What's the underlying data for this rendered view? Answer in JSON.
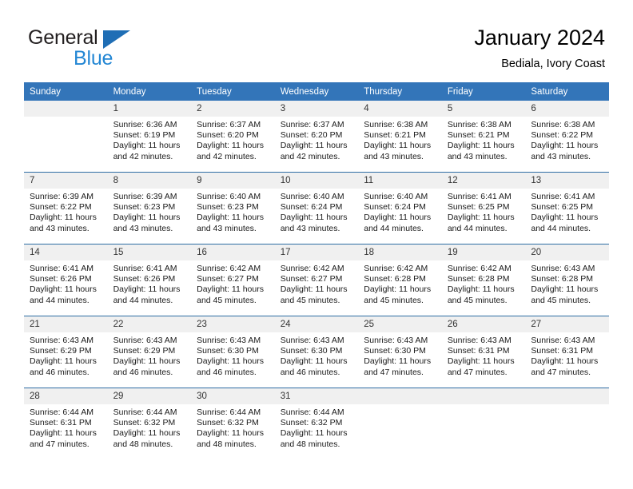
{
  "brand": {
    "name_part1": "General",
    "name_part2": "Blue",
    "triangle_icon": "triangle-icon"
  },
  "header": {
    "title": "January 2024",
    "subtitle": "Bediala, Ivory Coast"
  },
  "colors": {
    "header_blue": "#3375b9",
    "row_divider_blue": "#2e6da4",
    "daynum_band": "#f0f0f0",
    "brand_blue": "#2487d4",
    "logo_triangle": "#1f6eb5"
  },
  "weekdays": [
    "Sunday",
    "Monday",
    "Tuesday",
    "Wednesday",
    "Thursday",
    "Friday",
    "Saturday"
  ],
  "weeks": [
    [
      {
        "day": "",
        "sunrise": "",
        "sunset": "",
        "daylight": "",
        "daylight2": "",
        "blank": true
      },
      {
        "day": "1",
        "sunrise": "Sunrise: 6:36 AM",
        "sunset": "Sunset: 6:19 PM",
        "daylight": "Daylight: 11 hours",
        "daylight2": "and 42 minutes."
      },
      {
        "day": "2",
        "sunrise": "Sunrise: 6:37 AM",
        "sunset": "Sunset: 6:20 PM",
        "daylight": "Daylight: 11 hours",
        "daylight2": "and 42 minutes."
      },
      {
        "day": "3",
        "sunrise": "Sunrise: 6:37 AM",
        "sunset": "Sunset: 6:20 PM",
        "daylight": "Daylight: 11 hours",
        "daylight2": "and 42 minutes."
      },
      {
        "day": "4",
        "sunrise": "Sunrise: 6:38 AM",
        "sunset": "Sunset: 6:21 PM",
        "daylight": "Daylight: 11 hours",
        "daylight2": "and 43 minutes."
      },
      {
        "day": "5",
        "sunrise": "Sunrise: 6:38 AM",
        "sunset": "Sunset: 6:21 PM",
        "daylight": "Daylight: 11 hours",
        "daylight2": "and 43 minutes."
      },
      {
        "day": "6",
        "sunrise": "Sunrise: 6:38 AM",
        "sunset": "Sunset: 6:22 PM",
        "daylight": "Daylight: 11 hours",
        "daylight2": "and 43 minutes."
      }
    ],
    [
      {
        "day": "7",
        "sunrise": "Sunrise: 6:39 AM",
        "sunset": "Sunset: 6:22 PM",
        "daylight": "Daylight: 11 hours",
        "daylight2": "and 43 minutes."
      },
      {
        "day": "8",
        "sunrise": "Sunrise: 6:39 AM",
        "sunset": "Sunset: 6:23 PM",
        "daylight": "Daylight: 11 hours",
        "daylight2": "and 43 minutes."
      },
      {
        "day": "9",
        "sunrise": "Sunrise: 6:40 AM",
        "sunset": "Sunset: 6:23 PM",
        "daylight": "Daylight: 11 hours",
        "daylight2": "and 43 minutes."
      },
      {
        "day": "10",
        "sunrise": "Sunrise: 6:40 AM",
        "sunset": "Sunset: 6:24 PM",
        "daylight": "Daylight: 11 hours",
        "daylight2": "and 43 minutes."
      },
      {
        "day": "11",
        "sunrise": "Sunrise: 6:40 AM",
        "sunset": "Sunset: 6:24 PM",
        "daylight": "Daylight: 11 hours",
        "daylight2": "and 44 minutes."
      },
      {
        "day": "12",
        "sunrise": "Sunrise: 6:41 AM",
        "sunset": "Sunset: 6:25 PM",
        "daylight": "Daylight: 11 hours",
        "daylight2": "and 44 minutes."
      },
      {
        "day": "13",
        "sunrise": "Sunrise: 6:41 AM",
        "sunset": "Sunset: 6:25 PM",
        "daylight": "Daylight: 11 hours",
        "daylight2": "and 44 minutes."
      }
    ],
    [
      {
        "day": "14",
        "sunrise": "Sunrise: 6:41 AM",
        "sunset": "Sunset: 6:26 PM",
        "daylight": "Daylight: 11 hours",
        "daylight2": "and 44 minutes."
      },
      {
        "day": "15",
        "sunrise": "Sunrise: 6:41 AM",
        "sunset": "Sunset: 6:26 PM",
        "daylight": "Daylight: 11 hours",
        "daylight2": "and 44 minutes."
      },
      {
        "day": "16",
        "sunrise": "Sunrise: 6:42 AM",
        "sunset": "Sunset: 6:27 PM",
        "daylight": "Daylight: 11 hours",
        "daylight2": "and 45 minutes."
      },
      {
        "day": "17",
        "sunrise": "Sunrise: 6:42 AM",
        "sunset": "Sunset: 6:27 PM",
        "daylight": "Daylight: 11 hours",
        "daylight2": "and 45 minutes."
      },
      {
        "day": "18",
        "sunrise": "Sunrise: 6:42 AM",
        "sunset": "Sunset: 6:28 PM",
        "daylight": "Daylight: 11 hours",
        "daylight2": "and 45 minutes."
      },
      {
        "day": "19",
        "sunrise": "Sunrise: 6:42 AM",
        "sunset": "Sunset: 6:28 PM",
        "daylight": "Daylight: 11 hours",
        "daylight2": "and 45 minutes."
      },
      {
        "day": "20",
        "sunrise": "Sunrise: 6:43 AM",
        "sunset": "Sunset: 6:28 PM",
        "daylight": "Daylight: 11 hours",
        "daylight2": "and 45 minutes."
      }
    ],
    [
      {
        "day": "21",
        "sunrise": "Sunrise: 6:43 AM",
        "sunset": "Sunset: 6:29 PM",
        "daylight": "Daylight: 11 hours",
        "daylight2": "and 46 minutes."
      },
      {
        "day": "22",
        "sunrise": "Sunrise: 6:43 AM",
        "sunset": "Sunset: 6:29 PM",
        "daylight": "Daylight: 11 hours",
        "daylight2": "and 46 minutes."
      },
      {
        "day": "23",
        "sunrise": "Sunrise: 6:43 AM",
        "sunset": "Sunset: 6:30 PM",
        "daylight": "Daylight: 11 hours",
        "daylight2": "and 46 minutes."
      },
      {
        "day": "24",
        "sunrise": "Sunrise: 6:43 AM",
        "sunset": "Sunset: 6:30 PM",
        "daylight": "Daylight: 11 hours",
        "daylight2": "and 46 minutes."
      },
      {
        "day": "25",
        "sunrise": "Sunrise: 6:43 AM",
        "sunset": "Sunset: 6:30 PM",
        "daylight": "Daylight: 11 hours",
        "daylight2": "and 47 minutes."
      },
      {
        "day": "26",
        "sunrise": "Sunrise: 6:43 AM",
        "sunset": "Sunset: 6:31 PM",
        "daylight": "Daylight: 11 hours",
        "daylight2": "and 47 minutes."
      },
      {
        "day": "27",
        "sunrise": "Sunrise: 6:43 AM",
        "sunset": "Sunset: 6:31 PM",
        "daylight": "Daylight: 11 hours",
        "daylight2": "and 47 minutes."
      }
    ],
    [
      {
        "day": "28",
        "sunrise": "Sunrise: 6:44 AM",
        "sunset": "Sunset: 6:31 PM",
        "daylight": "Daylight: 11 hours",
        "daylight2": "and 47 minutes."
      },
      {
        "day": "29",
        "sunrise": "Sunrise: 6:44 AM",
        "sunset": "Sunset: 6:32 PM",
        "daylight": "Daylight: 11 hours",
        "daylight2": "and 48 minutes."
      },
      {
        "day": "30",
        "sunrise": "Sunrise: 6:44 AM",
        "sunset": "Sunset: 6:32 PM",
        "daylight": "Daylight: 11 hours",
        "daylight2": "and 48 minutes."
      },
      {
        "day": "31",
        "sunrise": "Sunrise: 6:44 AM",
        "sunset": "Sunset: 6:32 PM",
        "daylight": "Daylight: 11 hours",
        "daylight2": "and 48 minutes."
      },
      {
        "day": "",
        "sunrise": "",
        "sunset": "",
        "daylight": "",
        "daylight2": "",
        "blank": true
      },
      {
        "day": "",
        "sunrise": "",
        "sunset": "",
        "daylight": "",
        "daylight2": "",
        "blank": true
      },
      {
        "day": "",
        "sunrise": "",
        "sunset": "",
        "daylight": "",
        "daylight2": "",
        "blank": true
      }
    ]
  ]
}
